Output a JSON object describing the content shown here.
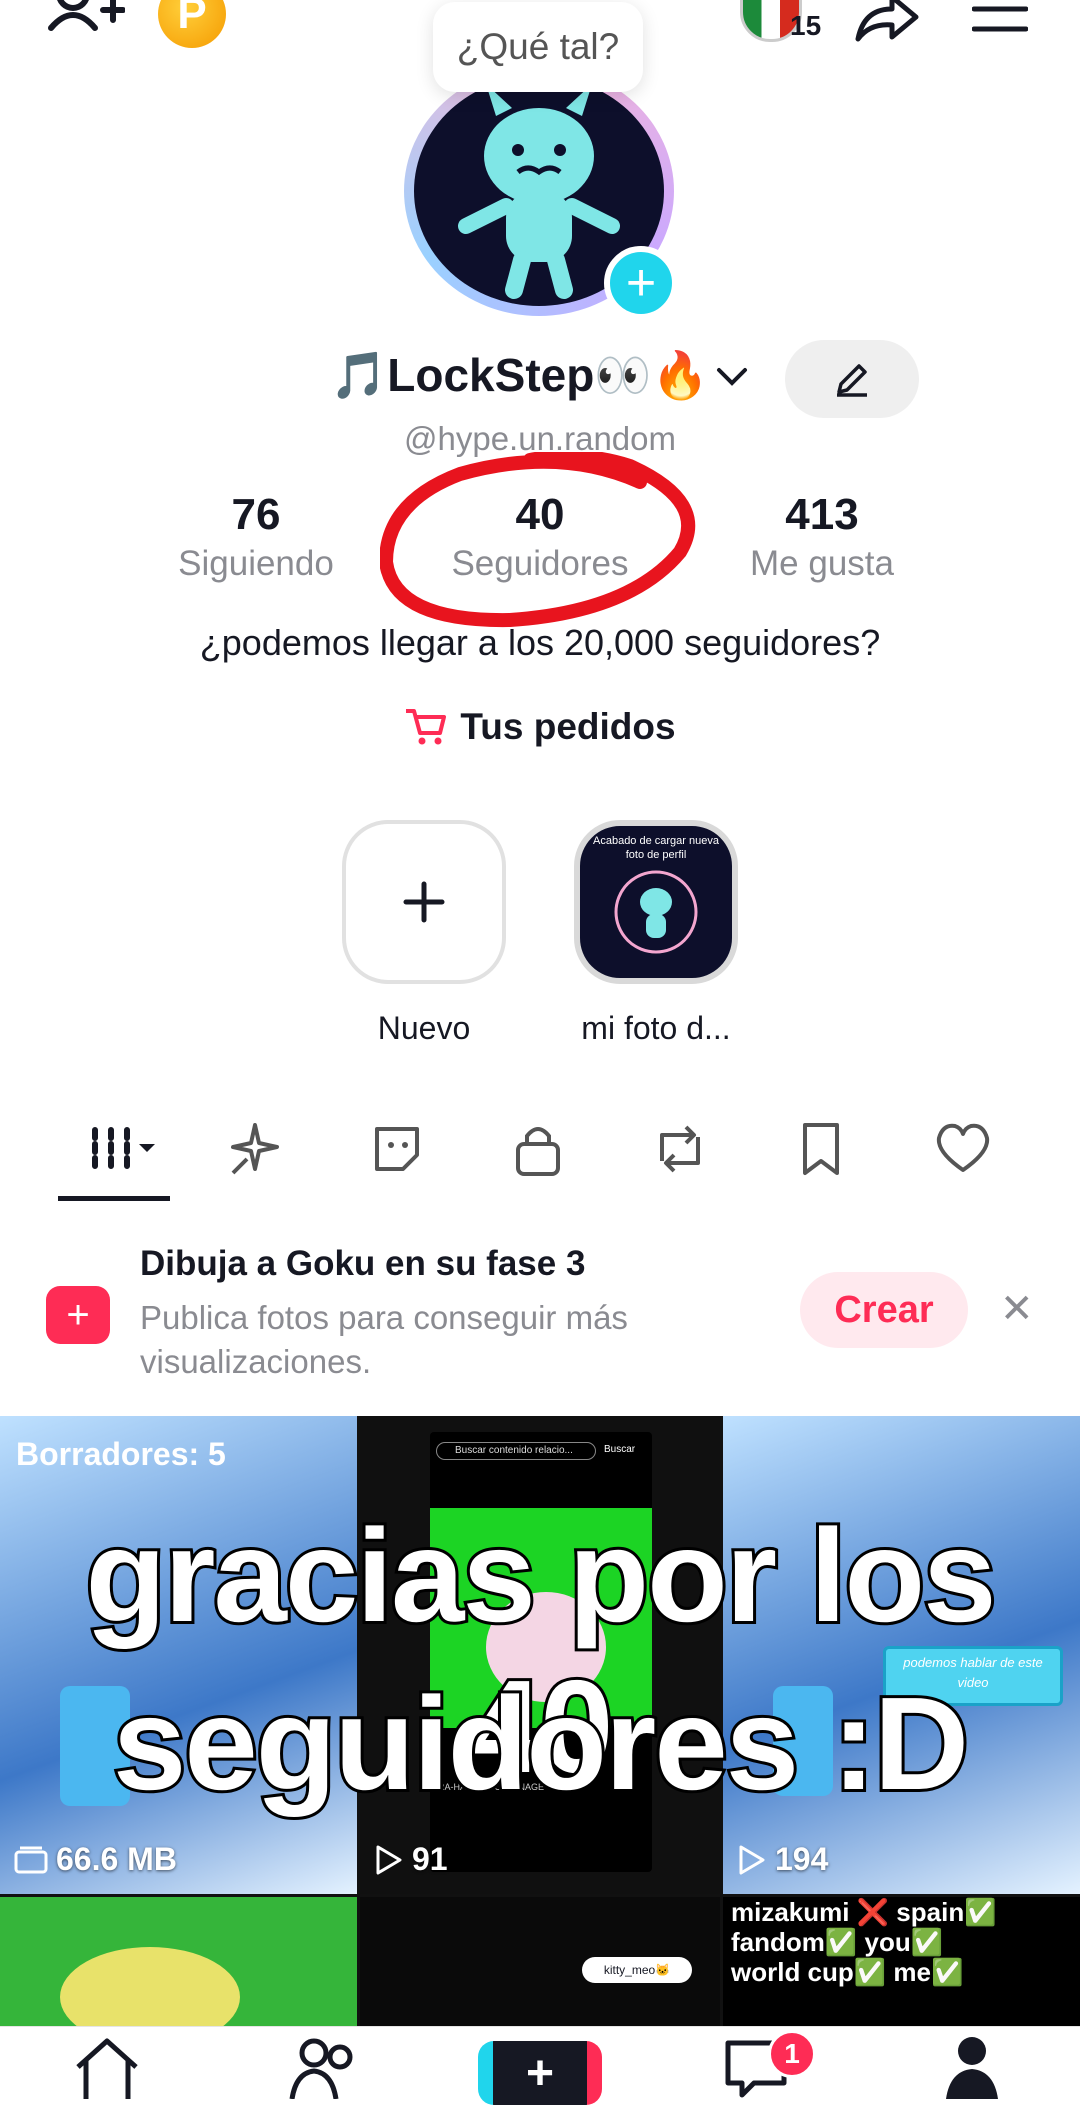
{
  "header": {
    "coin_label": "P",
    "bubble_text": "¿Qué tal?",
    "notification_count": "15"
  },
  "profile": {
    "display_name": "🎵LockStep👀🔥",
    "handle": "@hype.un.random",
    "stats": [
      {
        "value": "76",
        "label": "Siguiendo"
      },
      {
        "value": "40",
        "label": "Seguidores"
      },
      {
        "value": "413",
        "label": "Me gusta"
      }
    ],
    "bio": "¿podemos llegar a los 20,000 seguidores?",
    "orders_label": "Tus pedidos"
  },
  "highlights": [
    {
      "label": "Nuevo"
    },
    {
      "label": "mi foto d...",
      "thumb_caption": "Acabado de cargar nueva foto de perfil"
    }
  ],
  "tabs": [
    "videos-tab",
    "reposts-spark-tab",
    "stickers-tab",
    "private-tab",
    "reposts-tab",
    "saved-tab",
    "liked-tab"
  ],
  "banner": {
    "title": "Dibuja a Goku en su fase 3",
    "description": "Publica fotos para conseguir más visualizaciones.",
    "button": "Crear"
  },
  "grid": {
    "cells": [
      {
        "top_label": "Borradores: 5",
        "stat": "66.6 MB"
      },
      {
        "stat": "91",
        "screen_search": "Buscar contenido relacio...",
        "screen_button": "Buscar",
        "screen_caption": "RA-HAIFORGOTTENAGE"
      },
      {
        "stat": "194",
        "caption": "podemos hablar de este video"
      },
      {
        "caption_lines": [
          "mizakumi ❌ spain✅",
          "fandom✅ you✅",
          "world cup✅ me✅"
        ]
      }
    ],
    "bottom_cell_tag": "kitty_meo🐱"
  },
  "overlay_text": [
    "gracias por los 40",
    "seguidores :D"
  ],
  "bottom_nav": {
    "items": [
      "home-icon",
      "friends-icon",
      "create-button",
      "inbox-icon",
      "profile-icon"
    ],
    "inbox_badge": "1"
  },
  "colors": {
    "accent_red": "#fe2c55",
    "accent_cyan": "#20d5ec",
    "text_gray": "#8a8b91"
  }
}
